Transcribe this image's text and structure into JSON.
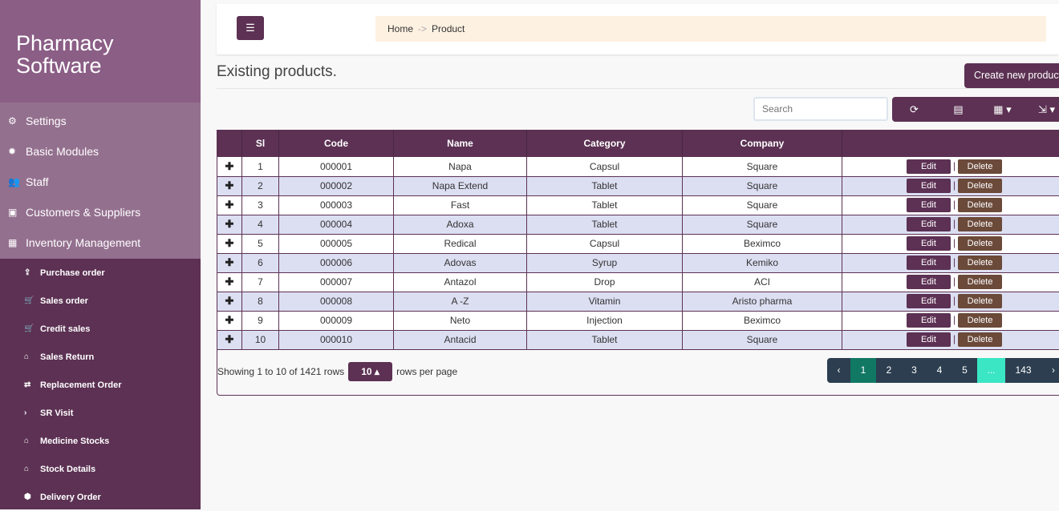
{
  "brand": "Pharmacy Software",
  "menu": [
    {
      "icon": "cogs-icon",
      "glyph": "⚙",
      "label": "Settings"
    },
    {
      "icon": "gear-icon",
      "glyph": "✹",
      "label": "Basic Modules"
    },
    {
      "icon": "users-icon",
      "glyph": "👥",
      "label": "Staff"
    },
    {
      "icon": "contact-icon",
      "glyph": "▣",
      "label": "Customers & Suppliers"
    },
    {
      "icon": "calculator-icon",
      "glyph": "▦",
      "label": "Inventory Management"
    }
  ],
  "submenu": [
    {
      "icon": "upload-icon",
      "glyph": "⇪",
      "label": "Purchase order"
    },
    {
      "icon": "cart-icon",
      "glyph": "🛒",
      "label": "Sales order"
    },
    {
      "icon": "cart-icon",
      "glyph": "🛒",
      "label": "Credit sales"
    },
    {
      "icon": "home-icon",
      "glyph": "⌂",
      "label": "Sales Return"
    },
    {
      "icon": "retweet-icon",
      "glyph": "⇄",
      "label": "Replacement Order"
    },
    {
      "icon": "chevron-right-icon",
      "glyph": "›",
      "label": "SR Visit"
    },
    {
      "icon": "home-icon",
      "glyph": "⌂",
      "label": "Medicine Stocks"
    },
    {
      "icon": "home-icon",
      "glyph": "⌂",
      "label": "Stock Details"
    },
    {
      "icon": "cube-icon",
      "glyph": "⬢",
      "label": "Delivery Order"
    }
  ],
  "breadcrumb": {
    "home": "Home",
    "sep": "->",
    "current": "Product"
  },
  "page_title": "Existing products.",
  "create_label": "Create new product",
  "search_placeholder": "Search",
  "columns": [
    "Sl",
    "Code",
    "Name",
    "Category",
    "Company"
  ],
  "rows": [
    [
      "1",
      "000001",
      "Napa",
      "Capsul",
      "Square"
    ],
    [
      "2",
      "000002",
      "Napa Extend",
      "Tablet",
      "Square"
    ],
    [
      "3",
      "000003",
      "Fast",
      "Tablet",
      "Square"
    ],
    [
      "4",
      "000004",
      "Adoxa",
      "Tablet",
      "Square"
    ],
    [
      "5",
      "000005",
      "Redical",
      "Capsul",
      "Beximco"
    ],
    [
      "6",
      "000006",
      "Adovas",
      "Syrup",
      "Kemiko"
    ],
    [
      "7",
      "000007",
      "Antazol",
      "Drop",
      "ACI"
    ],
    [
      "8",
      "000008",
      "A -Z",
      "Vitamin",
      "Aristo pharma"
    ],
    [
      "9",
      "000009",
      "Neto",
      "Injection",
      "Beximco"
    ],
    [
      "10",
      "000010",
      "Antacid",
      "Tablet",
      "Square"
    ]
  ],
  "actions": {
    "edit": "Edit",
    "delete": "Delete"
  },
  "footer": {
    "showing": "Showing 1 to 10 of 1421 rows",
    "page_size": "10 ▴",
    "rows_per_page": "rows per page"
  },
  "pagination": [
    "‹",
    "1",
    "2",
    "3",
    "4",
    "5",
    "...",
    "143",
    "›"
  ],
  "active_page": "1"
}
